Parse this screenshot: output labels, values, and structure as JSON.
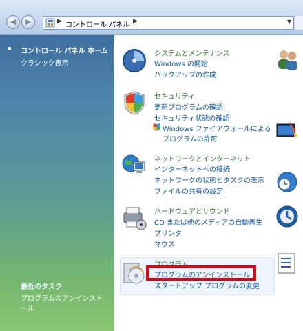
{
  "address_bar": {
    "path": "コントロール パネル"
  },
  "sidebar": {
    "items": [
      {
        "label": "コントロール パネル ホーム"
      },
      {
        "label": "クラシック表示"
      }
    ],
    "tasks_title": "最近のタスク",
    "tasks": [
      {
        "label": "プログラムのアンインストール"
      }
    ]
  },
  "categories": [
    {
      "title": "システムとメンテナンス",
      "links": [
        "Windows の開始",
        "バックアップの作成"
      ]
    },
    {
      "title": "セキュリティ",
      "links": [
        "更新プログラムの確認",
        "セキュリティ状態の確認",
        "Windows ファイアウォールによる",
        "プログラムの許可"
      ]
    },
    {
      "title": "ネットワークとインターネット",
      "links": [
        "インターネットへの接続",
        "ネットワークの状態とタスクの表示",
        "ファイルの共有の設定"
      ]
    },
    {
      "title": "ハードウェアとサウンド",
      "links": [
        "CD または他のメディアの自動再生",
        "プリンタ",
        "マウス"
      ]
    },
    {
      "title": "プログラム",
      "links": [
        "プログラムのアンインストール",
        "スタートアップ プログラムの変更"
      ]
    }
  ],
  "colors": {
    "category_title": "#2b7d2b",
    "link": "#0a57a8",
    "highlight": "#e60012"
  }
}
